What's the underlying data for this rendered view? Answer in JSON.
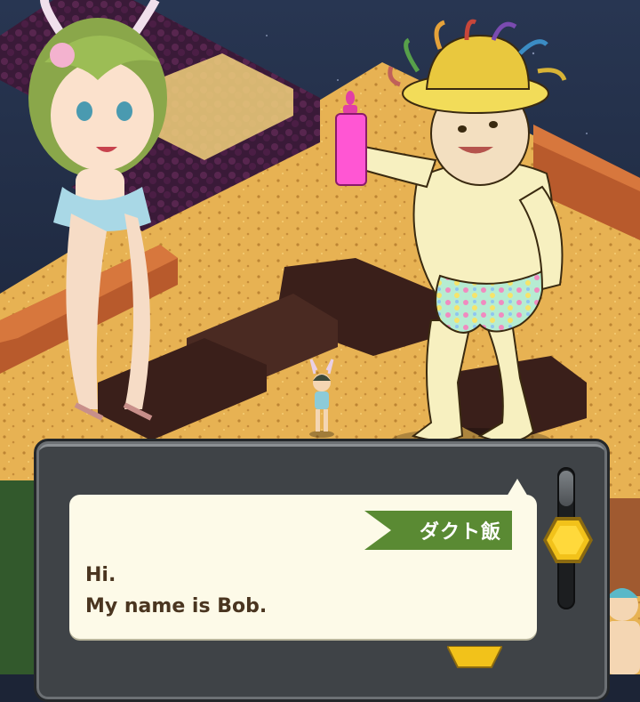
{
  "dialog": {
    "speaker_name": "ダクト飯",
    "lines": [
      "Hi.",
      "My name is Bob."
    ]
  },
  "colors": {
    "name_tag": "#5a8a33",
    "dialog_text": "#4a3520",
    "bubble": "#fdfae8",
    "accent_gold": "#f2c21a"
  },
  "icons": {
    "skip": "hexagon-icon",
    "next": "down-arrow-icon"
  }
}
